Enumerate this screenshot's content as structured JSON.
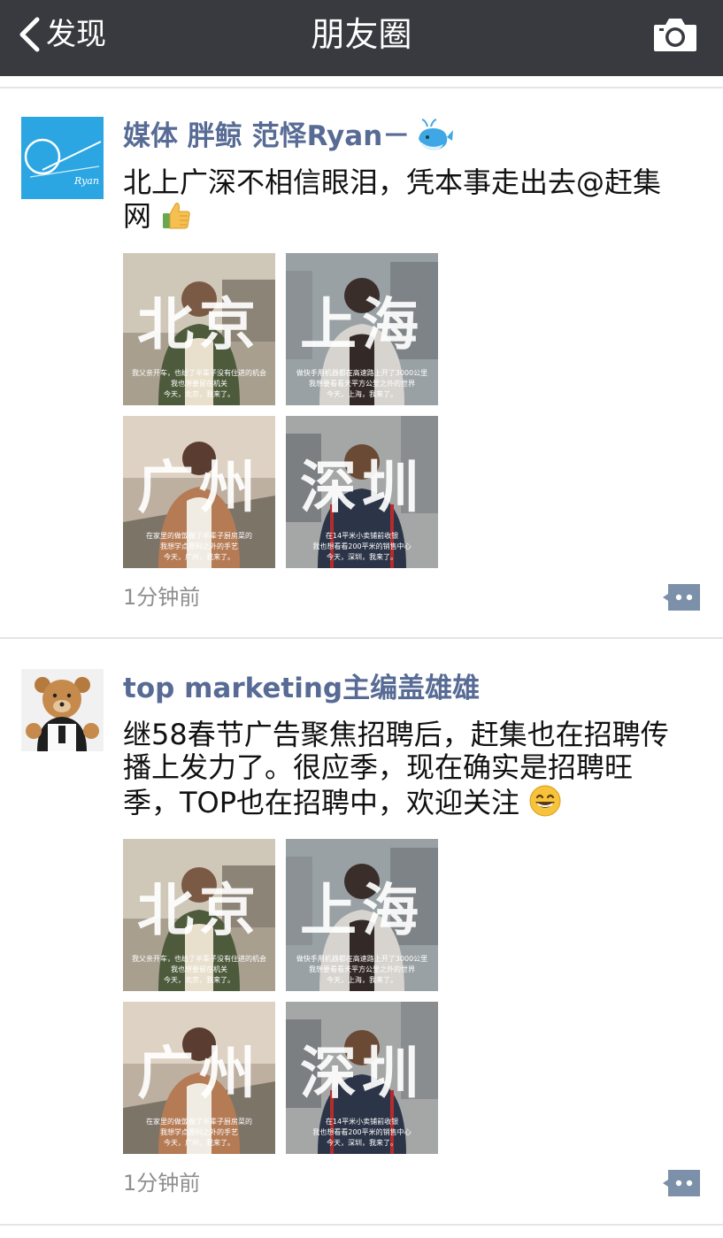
{
  "navbar": {
    "back_label": "发现",
    "title": "朋友圈",
    "camera_icon": "camera-icon"
  },
  "posts": [
    {
      "author": "媒体 胖鲸 范怿Ryan－",
      "author_emoji": "whale-icon",
      "avatar_label": "Ryan",
      "text_line1": "北上广深不相信眼泪，凭本事走出去@赶集",
      "text_line2": "网",
      "text_emoji": "thumbs-up-icon",
      "images": [
        {
          "city": "北京",
          "caption1": "我父亲开车，也给了半辈子没有住进的机会",
          "caption2": "我也想要留在机关",
          "caption3": "今天，北京，我来了。"
        },
        {
          "city": "上海",
          "caption1": "做快手用机器都在高速路上开了3000公里",
          "caption2": "我想要看看天平方公里之外的世界",
          "caption3": "今天，上海，我来了。"
        },
        {
          "city": "广州",
          "caption1": "在家里的做饭做了半辈子厨房菜的",
          "caption2": "我想学点原料之外的手艺",
          "caption3": "今天，广州，我来了。"
        },
        {
          "city": "深圳",
          "caption1": "在14平米小卖铺前收银",
          "caption2": "我也想看看200平米的销售中心",
          "caption3": "今天，深圳，我来了。"
        }
      ],
      "time": "1分钟前",
      "comment_icon": "comment-icon"
    },
    {
      "author": "top marketing主编盖雄雄",
      "text_line1": "继58春节广告聚焦招聘后，赶集也在招聘传",
      "text_line2": "播上发力了。很应季，现在确实是招聘旺",
      "text_line3": "季，TOP也在招聘中，欢迎关注",
      "text_emoji": "grinning-face-icon",
      "images": [
        {
          "city": "北京",
          "caption1": "我父亲开车，也给了半辈子没有住进的机会",
          "caption2": "我也想要留在机关",
          "caption3": "今天，北京，我来了。"
        },
        {
          "city": "上海",
          "caption1": "做快手用机器都在高速路上开了3000公里",
          "caption2": "我想要看看天平方公里之外的世界",
          "caption3": "今天，上海，我来了。"
        },
        {
          "city": "广州",
          "caption1": "在家里的做饭做了半辈子厨房菜的",
          "caption2": "我想学点原料之外的手艺",
          "caption3": "今天，广州，我来了。"
        },
        {
          "city": "深圳",
          "caption1": "在14平米小卖铺前收银",
          "caption2": "我也想看看200平米的销售中心",
          "caption3": "今天，深圳，我来了。"
        }
      ],
      "time": "1分钟前",
      "comment_icon": "comment-icon"
    }
  ],
  "colors": {
    "navbar": "#393a3f",
    "author_name": "#576b95",
    "timestamp": "#8e8e8e",
    "comment_button": "#7d90a9"
  }
}
